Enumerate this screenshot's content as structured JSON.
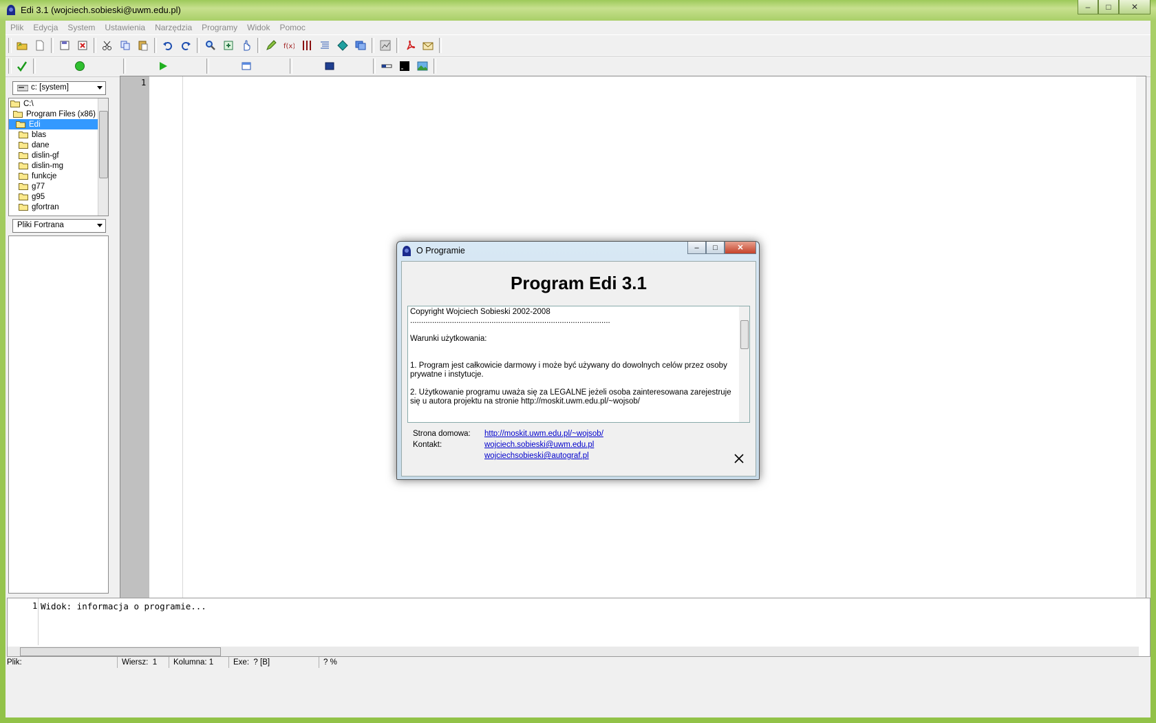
{
  "window": {
    "title": "Edi 3.1 (wojciech.sobieski@uwm.edu.pl)"
  },
  "menu": [
    "Plik",
    "Edycja",
    "System",
    "Ustawienia",
    "Narzędzia",
    "Programy",
    "Widok",
    "Pomoc"
  ],
  "left_panel": {
    "drive_selector": "c: [system]",
    "tree": [
      {
        "label": "C:\\",
        "selected": false
      },
      {
        "label": "Program Files (x86)",
        "selected": false
      },
      {
        "label": "Edi",
        "selected": true
      },
      {
        "label": "blas",
        "selected": false
      },
      {
        "label": "dane",
        "selected": false
      },
      {
        "label": "dislin-gf",
        "selected": false
      },
      {
        "label": "dislin-mg",
        "selected": false
      },
      {
        "label": "funkcje",
        "selected": false
      },
      {
        "label": "g77",
        "selected": false
      },
      {
        "label": "g95",
        "selected": false
      },
      {
        "label": "gfortran",
        "selected": false
      }
    ],
    "file_filter": "Pliki Fortrana"
  },
  "editor": {
    "line_number": "1"
  },
  "output": {
    "line_number": "1",
    "text": "Widok: informacja o programie..."
  },
  "statusbar": {
    "file_label": "Plik:",
    "row_label": "Wiersz:",
    "row_value": "1",
    "col_label": "Kolumna: 1",
    "exe_label": "Exe:",
    "exe_value": "? [B]",
    "percent": "? %"
  },
  "dialog": {
    "title": "O Programie",
    "heading": "Program Edi 3.1",
    "license_lines": [
      "Copyright Wojciech Sobieski 2002-2008",
      "..............................................................................................",
      "",
      "Warunki użytkowania:",
      "",
      "",
      "1. Program jest całkowicie darmowy i może być używany do dowolnych celów przez osoby prywatne i instytucje.",
      "",
      "2. Użytkowanie programu uważa się za LEGALNE jeżeli osoba zainteresowana zarejestruje się u autora projektu na stronie http://moskit.uwm.edu.pl/~wojsob/"
    ],
    "homepage_label": "Strona domowa:",
    "homepage_url": "http://moskit.uwm.edu.pl/~wojsob/",
    "contact_label": "Kontakt:",
    "contact_email_1": "wojciech.sobieski@uwm.edu.pl",
    "contact_email_2": "wojciechsobieski@autograf.pl"
  }
}
